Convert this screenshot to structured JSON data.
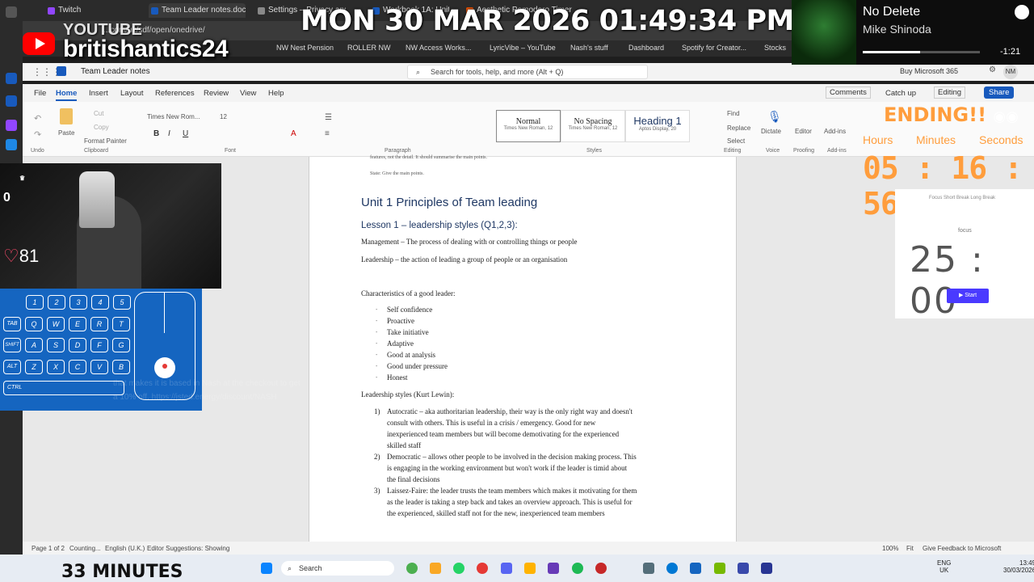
{
  "browser": {
    "tabs": [
      {
        "label": "Twitch",
        "color": "#9146ff",
        "active": false
      },
      {
        "label": "Team Leader notes.docx",
        "color": "#185abd",
        "active": true
      },
      {
        "label": "Settings – Privacy and se...",
        "color": "#888888",
        "active": false
      },
      {
        "label": "Workbook 1A: Units 1, 2 a...",
        "color": "#185abd",
        "active": false
      },
      {
        "label": "Aesthetic Pomodoro Timer",
        "color": "#e65100",
        "active": false
      }
    ],
    "url": "...com/uk/sdf/open/onedrive/",
    "bookmarks": [
      "NW Nest Pension",
      "ROLLER NW",
      "NW Access Works...",
      "LyricVibe – YouTube",
      "Nash's stuff",
      "Dashboard",
      "Spotify for Creator...",
      "Stocks"
    ]
  },
  "overlay": {
    "datetime": "MON 30 MAR 2026 01:49:34 PM",
    "youtube_label": "YOUTUBE",
    "channel": "britishantics24",
    "webcam_counter": "0",
    "hearts": "81",
    "minutes_banner": "33 MINUTES",
    "ending": "ENDING!!",
    "timer_labels": [
      "Hours",
      "Minutes",
      "Seconds"
    ],
    "timer_value": "05 : 16 : 56",
    "faded_text": "that makes it is based in Nash at the checkout to get a 10% off. https://jsted.energy/discount/NASH",
    "keys_row1": [
      "1",
      "2",
      "3",
      "4",
      "5"
    ],
    "keys_row2": [
      "TAB",
      "Q",
      "W",
      "E",
      "R",
      "T"
    ],
    "keys_row3": [
      "SHIFT",
      "A",
      "S",
      "D",
      "F",
      "G"
    ],
    "keys_row4": [
      "ALT",
      "Z",
      "X",
      "C",
      "V",
      "B"
    ],
    "keys_row5": [
      "CTRL"
    ]
  },
  "spotify": {
    "title": "No Delete",
    "artist": "Mike Shinoda",
    "remaining": "-1:21",
    "progress": 0.49
  },
  "word": {
    "doc_name": "Team Leader notes",
    "search_placeholder": "Search for tools, help, and more (Alt + Q)",
    "buy": "Buy Microsoft 365",
    "user_initials": "NM",
    "menus": [
      "File",
      "Home",
      "Insert",
      "Layout",
      "References",
      "Review",
      "View",
      "Help"
    ],
    "active_menu": "Home",
    "actions": [
      "Comments",
      "Catch up",
      "Editing",
      "Share"
    ],
    "ribbon": {
      "undo_label": "Undo",
      "clipboard_label": "Clipboard",
      "paste": "Paste",
      "cut": "Cut",
      "copy": "Copy",
      "format_painter": "Format Painter",
      "font_name": "Times New Rom...",
      "font_size": "12",
      "font_label": "Font",
      "paragraph_label": "Paragraph",
      "styles_label": "Styles",
      "styles": [
        {
          "name": "Normal",
          "sub": "Times New Roman, 12"
        },
        {
          "name": "No Spacing",
          "sub": "Times New Roman, 12"
        },
        {
          "name": "Heading 1",
          "sub": "Aptos Display, 20"
        }
      ],
      "find": "Find",
      "replace": "Replace",
      "select": "Select",
      "editing_label": "Editing",
      "dictate": "Dictate",
      "voice_label": "Voice",
      "editor": "Editor",
      "proofing_label": "Proofing",
      "addins": "Add-ins",
      "addins_label": "Add-ins"
    },
    "status": {
      "page": "Page 1 of 2",
      "words": "Counting...",
      "language": "English (U.K.)",
      "suggestions": "Editor Suggestions: Showing",
      "zoom": "100%",
      "fit": "Fit",
      "feedback": "Give Feedback to Microsoft"
    }
  },
  "document": {
    "top_line": "features, not the detail. It should summarise the main points.",
    "state_line": "State: Give the main points.",
    "heading": "Unit 1 Principles of Team leading",
    "lesson": "Lesson 1 – leadership styles (Q1,2,3):",
    "management": "Management – The process of dealing with or controlling things or people",
    "leadership": "Leadership – the action of leading a group of people or an organisation",
    "characteristics_title": "Characteristics of a good leader:",
    "characteristics": [
      "Self confidence",
      "Proactive",
      "Take initiative",
      "Adaptive",
      "Good at analysis",
      "Good under pressure",
      "Honest"
    ],
    "styles_title": "Leadership styles (Kurt Lewin):",
    "styles": [
      {
        "num": "1)",
        "lines": [
          "Autocratic – aka authoritarian leadership, their way is the only right way and doesn't",
          "consult with others. This is useful in a crisis / emergency. Good for new",
          "inexperienced team members but will become demotivating for the experienced",
          "skilled staff"
        ]
      },
      {
        "num": "2)",
        "lines": [
          "Democratic – allows other people to be involved in the decision making process. This",
          "is engaging in the working environment but won't work if the leader is timid about",
          "the final decisions"
        ]
      },
      {
        "num": "3)",
        "lines": [
          "Laissez-Faire: the leader trusts the team members which makes it motivating for them",
          "as the leader is taking a step back and takes an overview approach. This is useful for",
          "the experienced, skilled staff not for the new, inexperienced team members"
        ]
      }
    ]
  },
  "pomodoro": {
    "tabs": "Focus    Short Break    Long Break",
    "mode": "focus",
    "time": "25 : 00",
    "start": "▶ Start"
  },
  "taskbar": {
    "search": "Search",
    "lang": "ENG",
    "region": "UK",
    "time": "13:49",
    "date": "30/03/2026"
  },
  "colors": {
    "word_blue": "#185abd",
    "timer_orange": "#ff9d3c",
    "keyboard_blue": "#1565c0",
    "pomodoro_button": "#4a3aff"
  }
}
